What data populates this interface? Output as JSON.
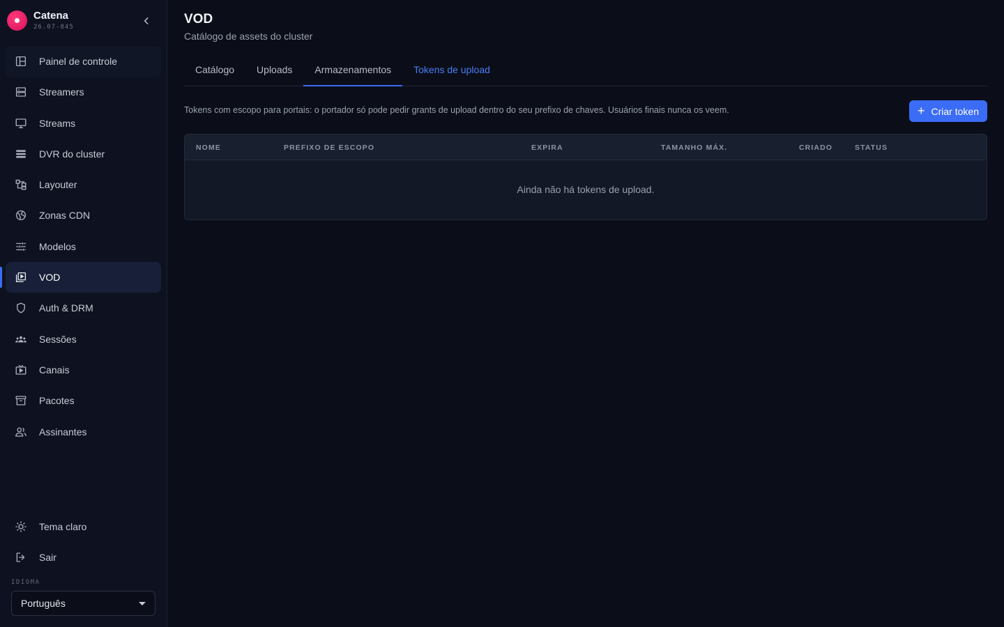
{
  "brand": {
    "name": "Catena",
    "version": "26.07-845"
  },
  "sidebar": {
    "items": [
      {
        "label": "Painel de controle",
        "icon": "dashboard-icon"
      },
      {
        "label": "Streamers",
        "icon": "server-icon"
      },
      {
        "label": "Streams",
        "icon": "monitor-icon"
      },
      {
        "label": "DVR do cluster",
        "icon": "storage-icon"
      },
      {
        "label": "Layouter",
        "icon": "layout-icon"
      },
      {
        "label": "Zonas CDN",
        "icon": "globe-icon"
      },
      {
        "label": "Modelos",
        "icon": "sliders-icon"
      },
      {
        "label": "VOD",
        "icon": "video-library-icon"
      },
      {
        "label": "Auth & DRM",
        "icon": "shield-icon"
      },
      {
        "label": "Sessões",
        "icon": "users-group-icon"
      },
      {
        "label": "Canais",
        "icon": "tv-icon"
      },
      {
        "label": "Pacotes",
        "icon": "archive-icon"
      },
      {
        "label": "Assinantes",
        "icon": "subscribers-icon"
      }
    ],
    "bottom": [
      {
        "label": "Tema claro",
        "icon": "sun-icon"
      },
      {
        "label": "Sair",
        "icon": "logout-icon"
      }
    ],
    "language_label": "IDIOMA",
    "language_value": "Português"
  },
  "page": {
    "title": "VOD",
    "subtitle": "Catálogo de assets do cluster"
  },
  "tabs": [
    {
      "label": "Catálogo"
    },
    {
      "label": "Uploads"
    },
    {
      "label": "Armazenamentos"
    },
    {
      "label": "Tokens de upload"
    }
  ],
  "content": {
    "description": "Tokens com escopo para portais: o portador só pode pedir grants de upload dentro do seu prefixo de chaves. Usuários finais nunca os veem.",
    "create_button": "Criar token",
    "create_plus": "+",
    "table": {
      "columns": [
        "NOME",
        "PREFIXO DE ESCOPO",
        "EXPIRA",
        "TAMANHO MÁX.",
        "CRIADO",
        "STATUS"
      ],
      "empty_message": "Ainda não há tokens de upload."
    }
  },
  "colors": {
    "accent": "#3b6cf6",
    "brand": "#e0145f",
    "background": "#0b0e18"
  }
}
